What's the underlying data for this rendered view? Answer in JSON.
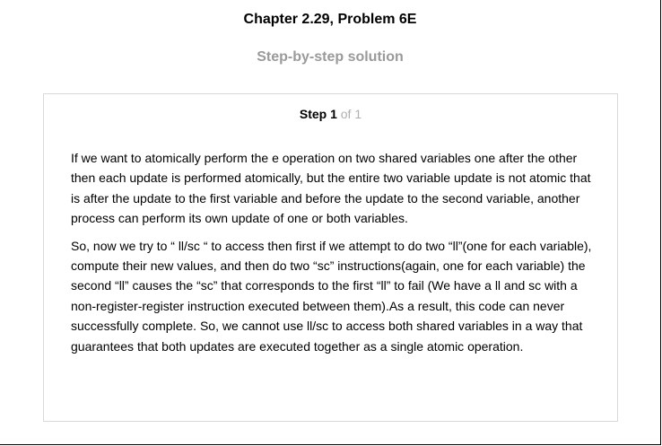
{
  "header": {
    "title": "Chapter 2.29, Problem 6E",
    "subtitle": "Step-by-step solution"
  },
  "step": {
    "label": "Step 1",
    "count": "of 1",
    "paragraphs": [
      "If we want to atomically perform the e operation on two shared variables one after the other then each update is performed atomically, but the entire two variable update is not atomic that is after the update to the first variable and before the update to the second variable, another process can perform its own update of one or both variables.",
      "So, now we try to “ ll/sc “ to access then first if we attempt to do two “ll”(one for each variable), compute their new values, and then do two “sc” instructions(again, one for each variable) the second “ll” causes the “sc” that corresponds to the first “ll” to fail (We have a ll and sc with a non-register-register instruction executed between them).As a result, this code can never successfully complete. So, we cannot use ll/sc to access both shared variables in a way that guarantees that both updates are executed together as a single atomic operation."
    ]
  },
  "colors": {
    "subtitle": "#9a9a9a",
    "step_count": "#b0b0b0",
    "card_border": "#d9d9d9"
  }
}
